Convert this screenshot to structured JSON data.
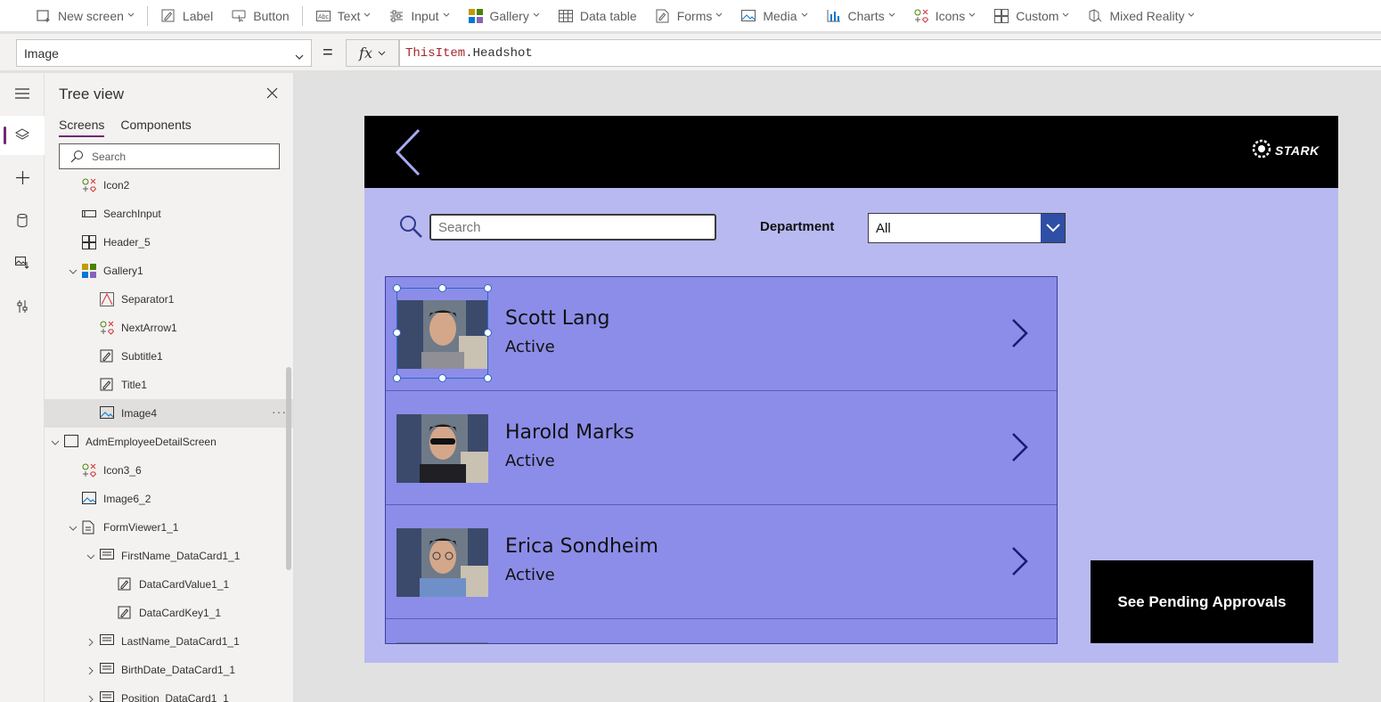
{
  "ribbon": {
    "items": [
      {
        "label": "New screen",
        "icon": "new-screen-icon",
        "dropdown": true
      },
      {
        "label": "Label",
        "icon": "label-icon",
        "dropdown": false
      },
      {
        "label": "Button",
        "icon": "button-icon",
        "dropdown": false
      },
      {
        "label": "Text",
        "icon": "text-icon",
        "dropdown": true
      },
      {
        "label": "Input",
        "icon": "input-icon",
        "dropdown": true
      },
      {
        "label": "Gallery",
        "icon": "gallery-icon",
        "dropdown": true
      },
      {
        "label": "Data table",
        "icon": "data-table-icon",
        "dropdown": false
      },
      {
        "label": "Forms",
        "icon": "forms-icon",
        "dropdown": true
      },
      {
        "label": "Media",
        "icon": "media-icon",
        "dropdown": true
      },
      {
        "label": "Charts",
        "icon": "charts-icon",
        "dropdown": true
      },
      {
        "label": "Icons",
        "icon": "icons-icon",
        "dropdown": true
      },
      {
        "label": "Custom",
        "icon": "custom-icon",
        "dropdown": true
      },
      {
        "label": "Mixed Reality",
        "icon": "mixed-reality-icon",
        "dropdown": true
      }
    ]
  },
  "formula_bar": {
    "property": "Image",
    "equals": "=",
    "fx": "fx",
    "formula_keyword": "ThisItem",
    "formula_rest": ".Headshot"
  },
  "tree_view": {
    "title": "Tree view",
    "tabs": [
      "Screens",
      "Components"
    ],
    "search_placeholder": "Search",
    "nodes": [
      {
        "label": "Icon2",
        "icon": "icon-control-icon"
      },
      {
        "label": "SearchInput",
        "icon": "text-input-icon"
      },
      {
        "label": "Header_5",
        "icon": "header-icon"
      },
      {
        "label": "Gallery1",
        "icon": "gallery-icon",
        "expanded": true
      },
      {
        "label": "Separator1",
        "icon": "separator-icon"
      },
      {
        "label": "NextArrow1",
        "icon": "icon-control-icon"
      },
      {
        "label": "Subtitle1",
        "icon": "label-icon"
      },
      {
        "label": "Title1",
        "icon": "label-icon"
      },
      {
        "label": "Image4",
        "icon": "image-icon",
        "selected": true
      },
      {
        "label": "AdmEmployeeDetailScreen",
        "icon": "screen-icon",
        "expanded": true
      },
      {
        "label": "Icon3_6",
        "icon": "icon-control-icon"
      },
      {
        "label": "Image6_2",
        "icon": "image-icon"
      },
      {
        "label": "FormViewer1_1",
        "icon": "form-icon",
        "expanded": true
      },
      {
        "label": "FirstName_DataCard1_1",
        "icon": "datacard-icon",
        "expanded": true
      },
      {
        "label": "DataCardValue1_1",
        "icon": "label-icon"
      },
      {
        "label": "DataCardKey1_1",
        "icon": "label-icon"
      },
      {
        "label": "LastName_DataCard1_1",
        "icon": "datacard-icon",
        "expanded": false
      },
      {
        "label": "BirthDate_DataCard1_1",
        "icon": "datacard-icon",
        "expanded": false
      },
      {
        "label": "Position_DataCard1_1",
        "icon": "datacard-icon",
        "expanded": false
      }
    ]
  },
  "app": {
    "logo_text": "STARK",
    "search_placeholder": "Search",
    "department_label": "Department",
    "department_value": "All",
    "employees": [
      {
        "name": "Scott Lang",
        "status": "Active"
      },
      {
        "name": "Harold Marks",
        "status": "Active"
      },
      {
        "name": "Erica Sondheim",
        "status": "Active"
      }
    ],
    "pending_button": "See Pending Approvals"
  },
  "colors": {
    "accent": "#742774",
    "screen_bg": "#b8b9f0",
    "gallery_item": "#8c8de8",
    "dropdown_button": "#2f4ea5",
    "formula_keyword": "#a4262c"
  }
}
